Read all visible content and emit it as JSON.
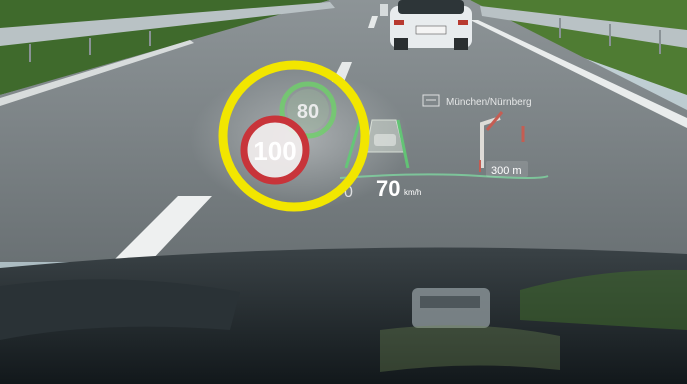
{
  "hud": {
    "speed_limit_primary": "100",
    "speed_limit_secondary": "80",
    "current_speed": "70",
    "speed_unit": "km/h",
    "current_speed_prefix": "0",
    "navigation_destination": "München/Nürnberg",
    "navigation_distance": "300 m"
  },
  "highlight": {
    "color": "#f2e600"
  }
}
